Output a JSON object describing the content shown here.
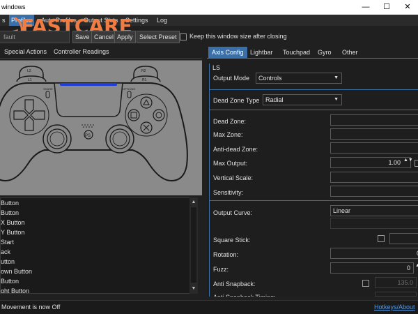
{
  "window": {
    "title": "windows",
    "controls": [
      "—",
      "☐",
      "✕"
    ]
  },
  "menu": {
    "items": [
      "s",
      "Profiles",
      "Auto Profiles",
      "Output Slots",
      "Settings",
      "Log"
    ]
  },
  "watermark": {
    "text": "FASTCARE"
  },
  "toolbar": {
    "profile_name": "fault",
    "save_label": "Save",
    "cancel_label": "Cancel",
    "apply_label": "Apply",
    "select_preset_label": "Select Preset",
    "keep_size_label": "Keep this window size after closing"
  },
  "left_tabs": [
    "Special Actions",
    "Controller Readings"
  ],
  "controller_labels": {
    "share": "SHARE",
    "options": "OPTIONS",
    "l1": "L1",
    "r1": "R1",
    "l2": "L2",
    "r2": "R2"
  },
  "action_list": [
    "Button",
    "Button",
    "X Button",
    "Y Button",
    "Start",
    "ack",
    "utton",
    "own Button",
    "Button",
    "ght Button"
  ],
  "right_tabs": [
    "Axis Config",
    "Lightbar",
    "Touchpad",
    "Gyro",
    "Other"
  ],
  "axis": {
    "group_label": "LS",
    "output_mode_label": "Output Mode",
    "output_mode_value": "Controls",
    "dead_zone_type_label": "Dead Zone Type",
    "dead_zone_type_value": "Radial",
    "dead_zone_label": "Dead Zone:",
    "max_zone_label": "Max Zone:",
    "anti_dead_zone_label": "Anti-dead Zone:",
    "max_output_label": "Max Output:",
    "max_output_value": "1.00",
    "vertical_scale_label": "Vertical Scale:",
    "sensitivity_label": "Sensitivity:",
    "output_curve_label": "Output Curve:",
    "output_curve_value": "Linear",
    "square_stick_label": "Square Stick:",
    "rotation_label": "Rotation:",
    "rotation_value": "0",
    "fuzz_label": "Fuzz:",
    "fuzz_value": "0",
    "anti_snapback_label": "Anti Snapback:",
    "anti_snapback_value": "135.0",
    "anti_snapback_timing_label": "Anti Snapback Timing:"
  },
  "status": {
    "message": "Movement is now Off",
    "hotkeys_link": "Hotkeys/About"
  },
  "colors": {
    "accent": "#3a6fa8",
    "watermark": "#ef7c43",
    "lightbar": "#1f3fd8"
  }
}
